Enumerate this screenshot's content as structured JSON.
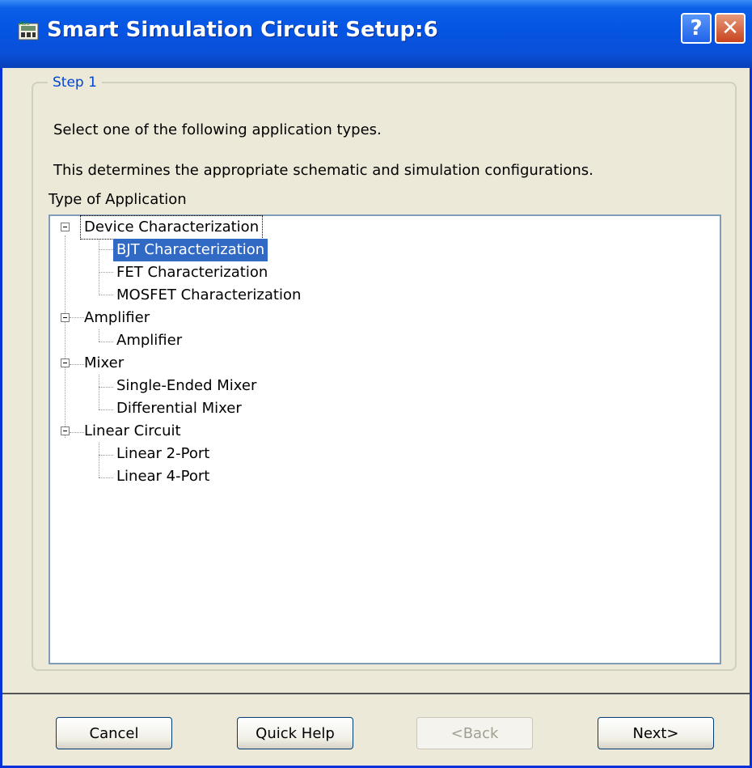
{
  "window": {
    "title": "Smart Simulation Circuit Setup:6",
    "help_label": "?",
    "close_label": "✕"
  },
  "step": {
    "legend": "Step 1",
    "instruction1": "Select one of the following application types.",
    "instruction2": "This determines the appropriate schematic and simulation configurations."
  },
  "tree": {
    "label": "Type of Application",
    "groups": [
      {
        "label": "Device Characterization",
        "expanded": true,
        "children": [
          "BJT Characterization",
          "FET Characterization",
          "MOSFET Characterization"
        ]
      },
      {
        "label": "Amplifier",
        "expanded": true,
        "children": [
          "Amplifier"
        ]
      },
      {
        "label": "Mixer",
        "expanded": true,
        "children": [
          "Single-Ended Mixer",
          "Differential Mixer"
        ]
      },
      {
        "label": "Linear Circuit",
        "expanded": true,
        "children": [
          "Linear 2-Port",
          "Linear 4-Port"
        ]
      }
    ],
    "selected": "BJT Characterization"
  },
  "buttons": {
    "cancel": "Cancel",
    "quick_help": "Quick Help",
    "back": "<Back",
    "next": "Next>"
  },
  "colors": {
    "titlebar": "#0554e3",
    "selection": "#316ac5",
    "legend": "#0046d5"
  }
}
